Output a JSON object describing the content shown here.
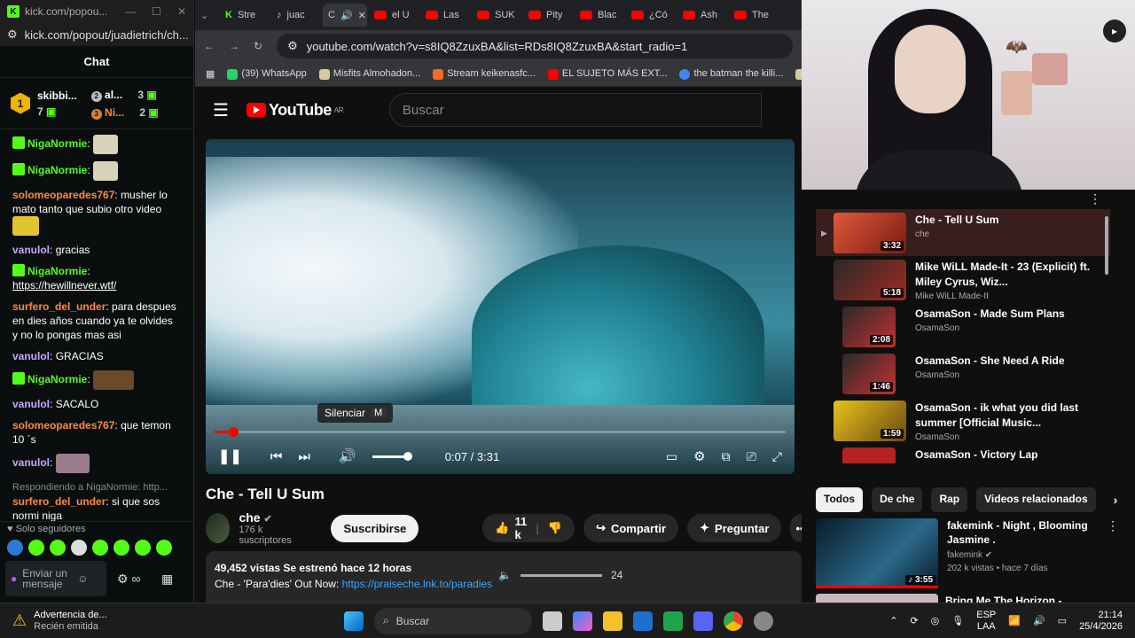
{
  "popup": {
    "window_title": "kick.com/popou...",
    "url": "kick.com/popout/juadietrich/ch...",
    "chat_title": "Chat",
    "top_gifters": [
      {
        "rank": "1",
        "name": "skibbi...",
        "count": "7"
      },
      {
        "rank": "2",
        "name": "al...",
        "count": "3"
      },
      {
        "rank": "3",
        "name": "Ni...",
        "count": "2"
      }
    ],
    "messages": [
      {
        "user": "NigaNormie",
        "text": ""
      },
      {
        "user": "NigaNormie",
        "text": ""
      },
      {
        "user": "solomeoparedes767",
        "text": "musher lo mato tanto que subio otro video"
      },
      {
        "user": "vanulol",
        "text": "gracias"
      },
      {
        "user": "NigaNormie",
        "text": ""
      },
      {
        "link": "https://hewillnever.wtf/"
      },
      {
        "user": "surfero_del_under",
        "text": "para despues en dies años cuando ya te olvides y no lo pongas mas asi"
      },
      {
        "user": "vanulol",
        "text": "GRACIAS"
      },
      {
        "user": "NigaNormie",
        "text": ""
      },
      {
        "user": "vanulol",
        "text": "SACALO"
      },
      {
        "user": "solomeoparedes767",
        "text": "que temon 10 ´s"
      },
      {
        "user": "vanulol",
        "text": ""
      }
    ],
    "reply_to": "Respondiendo a NigaNormie: http...",
    "last_message": {
      "user": "surfero_del_under",
      "text": "si que sos normi niga"
    },
    "followers_only": "Solo seguidores",
    "send_placeholder": "Enviar un mensaje"
  },
  "browser": {
    "tabs": [
      "Stre",
      "juac",
      "C",
      "el U",
      "Las",
      "SUK",
      "Pity",
      "Blac",
      "¿Có",
      "Ash",
      "The"
    ],
    "url": "youtube.com/watch?v=s8IQ8ZzuxBA&list=RDs8IQ8ZzuxBA&start_radio=1",
    "bookmarks": [
      "(39) WhatsApp",
      "Misfits Almohadon...",
      "Stream keikenasfc...",
      "EL SUJETO MÁS EXT...",
      "the batman the killi...",
      "H"
    ]
  },
  "youtube": {
    "logo": "YouTube",
    "region": "AR",
    "search_placeholder": "Buscar",
    "tooltip": "Silenciar",
    "tooltip_key": "M",
    "time": "0:07 / 3:31",
    "progress_fraction": 0.033,
    "title": "Che - Tell U Sum",
    "channel": "che",
    "subscribers": "176 k suscriptores",
    "subscribe": "Suscribirse",
    "likes": "11 k",
    "share": "Compartir",
    "ask": "Preguntar",
    "views_line": "49,452 vistas  Se estrenó hace 12 horas",
    "desc_prefix": "Che - 'Para'dies' Out Now:",
    "desc_link": "https://praiseche.lnk.to/paradies",
    "volume_value": "24",
    "playlist": [
      {
        "title": "Che - Tell U Sum",
        "channel": "che",
        "duration": "3:32",
        "color": "#c8382f"
      },
      {
        "title": "Mike WiLL Made-It - 23 (Explicit) ft. Miley Cyrus, Wiz...",
        "channel": "Mike WiLL Made-It",
        "duration": "5:18",
        "color": "#8a2a22"
      },
      {
        "title": "OsamaSon - Made Sum Plans",
        "channel": "OsamaSon",
        "duration": "2:08",
        "color": "#b52222"
      },
      {
        "title": "OsamaSon - She Need A Ride",
        "channel": "OsamaSon",
        "duration": "1:46",
        "color": "#b52222"
      },
      {
        "title": "OsamaSon - ik what you did last summer [Official Music...",
        "channel": "OsamaSon",
        "duration": "1:59",
        "color": "#d9b21c"
      },
      {
        "title": "OsamaSon - Victory Lap",
        "channel": "",
        "duration": "",
        "color": "#b52222"
      }
    ],
    "chips": [
      "Todos",
      "De che",
      "Rap",
      "Videos relacionados"
    ],
    "rec": {
      "title": "fakemink - Night , Blooming Jasmine .",
      "channel": "fakemink",
      "meta": "202 k vistas • hace 7 días",
      "duration": "3:55"
    },
    "rec2_title": "Bring Me The Horizon - Shadow..."
  },
  "taskbar": {
    "notification_title": "Advertencia de...",
    "notification_sub": "Recién emitida",
    "search": "Buscar",
    "lang": "ESP",
    "lang2": "LAA",
    "time": "21:14",
    "date": "25/4/2026"
  }
}
